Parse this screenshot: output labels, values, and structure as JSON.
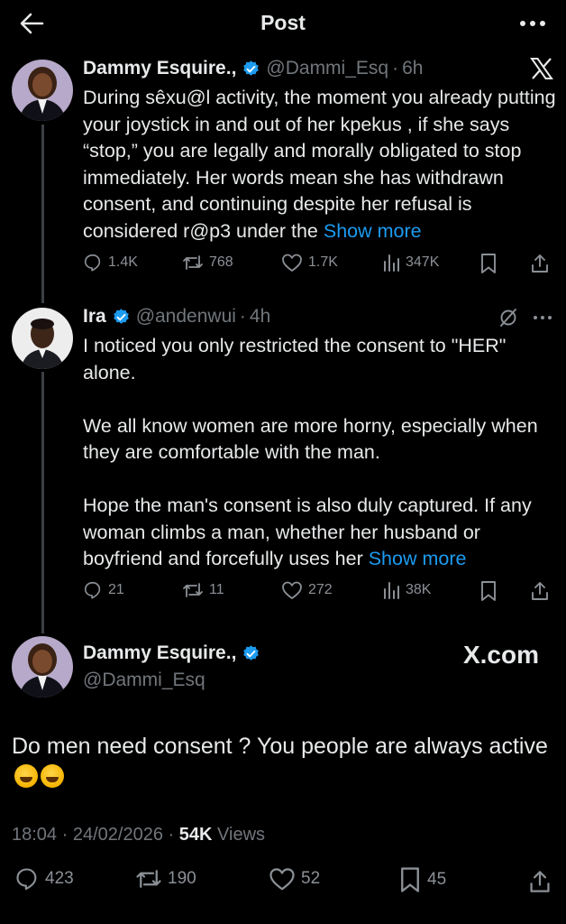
{
  "header": {
    "title": "Post",
    "back_icon": "arrow-left-icon",
    "more_icon": "more-horizontal-icon"
  },
  "tweets": [
    {
      "name": "Dammy Esquire.,",
      "handle": "@Dammi_Esq",
      "separator": "·",
      "time": "6h",
      "text": "During sêxu@l activity, the moment you already putting your joystick in and out of her kpekus , if she says “stop,” you are legally and morally obligated to stop immediately. Her words mean she has withdrawn consent, and continuing despite her refusal is considered r@p3 under the",
      "show_more": "Show more",
      "replies": "1.4K",
      "reposts": "768",
      "likes": "1.7K",
      "views": "347K"
    },
    {
      "name": "Ira",
      "handle": "@andenwui",
      "separator": "·",
      "time": "4h",
      "paragraphs": [
        "I noticed you only restricted the consent to \"HER\" alone.",
        "We all know women are more horny, especially when they are comfortable with the man.",
        "Hope the man's consent is also duly captured. If any woman climbs a man, whether her husband or boyfriend and forcefully uses her"
      ],
      "show_more": "Show more",
      "replies": "21",
      "reposts": "11",
      "likes": "272",
      "views": "38K"
    }
  ],
  "main_tweet": {
    "name": "Dammy Esquire.,",
    "handle": "@Dammi_Esq",
    "brand": "X.com",
    "text": "Do men need consent ? You people are always active",
    "emoji": "🤣🤣",
    "time": "18:04",
    "separator": "·",
    "date": "24/02/2026",
    "views_count": "54K",
    "views_label": "Views",
    "replies": "423",
    "reposts": "190",
    "likes": "52",
    "bookmarks": "45"
  },
  "colors": {
    "background": "#000000",
    "text": "#e7e9ea",
    "muted": "#71767b",
    "link": "#1d9bf0",
    "verified": "#1d9bf0",
    "thread_line": "#3a3f44"
  }
}
